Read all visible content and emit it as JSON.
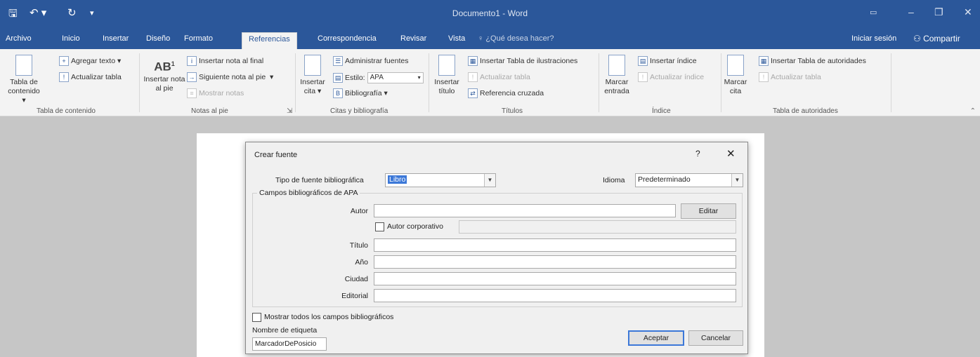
{
  "window": {
    "title": "Documento1 - Word",
    "qa_icons": {
      "save": "save-icon",
      "undo": "undo-icon",
      "redo": "redo-icon",
      "customize": "customize-qat-icon"
    }
  },
  "tabs": [
    {
      "label": "Archivo"
    },
    {
      "label": "Inicio"
    },
    {
      "label": "Insertar"
    },
    {
      "label": "Diseño"
    },
    {
      "label": "Formato"
    },
    {
      "label": "Referencias",
      "active": true
    },
    {
      "label": "Correspondencia"
    },
    {
      "label": "Revisar"
    },
    {
      "label": "Vista"
    }
  ],
  "tellme": "¿Qué desea hacer?",
  "signin": "Iniciar sesión",
  "share": "Compartir",
  "ribbon": {
    "toc": {
      "big": "Tabla de contenido",
      "add_text": "Agregar texto",
      "update_table": "Actualizar tabla",
      "label": "Tabla de contenido"
    },
    "footnotes": {
      "big": "Insertar nota al pie",
      "insert_endnote": "Insertar nota al final",
      "next_footnote": "Siguiente nota al pie",
      "show_notes": "Mostrar notas",
      "label": "Notas al pie"
    },
    "citations": {
      "big": "Insertar cita",
      "manage_sources": "Administrar fuentes",
      "style_label": "Estilo:",
      "style_value": "APA",
      "bibliography": "Bibliografía",
      "label": "Citas y bibliografía"
    },
    "captions": {
      "big": "Insertar título",
      "insert_figures_table": "Insertar Tabla de ilustraciones",
      "update_table": "Actualizar tabla",
      "cross_reference": "Referencia cruzada",
      "label": "Títulos"
    },
    "index": {
      "big": "Marcar entrada",
      "insert_index": "Insertar índice",
      "update_index": "Actualizar índice",
      "label": "Índice"
    },
    "authorities": {
      "big": "Marcar cita",
      "insert_table": "Insertar Tabla de autoridades",
      "update_table": "Actualizar tabla",
      "label": "Tabla de autoridades"
    }
  },
  "dialog": {
    "title": "Crear fuente",
    "help": "?",
    "close": "✕",
    "source_type_label": "Tipo de fuente bibliográfica",
    "source_type_value": "Libro",
    "language_label": "Idioma",
    "language_value": "Predeterminado",
    "fields_group": "Campos bibliográficos de APA",
    "author_label": "Autor",
    "edit_button": "Editar",
    "corporate_author": "Autor corporativo",
    "title_label": "Título",
    "year_label": "Año",
    "city_label": "Ciudad",
    "publisher_label": "Editorial",
    "show_all": "Mostrar todos los campos bibliográficos",
    "tag_name_label": "Nombre de etiqueta",
    "tag_name_value": "MarcadorDePosicio",
    "ok": "Aceptar",
    "cancel": "Cancelar"
  }
}
